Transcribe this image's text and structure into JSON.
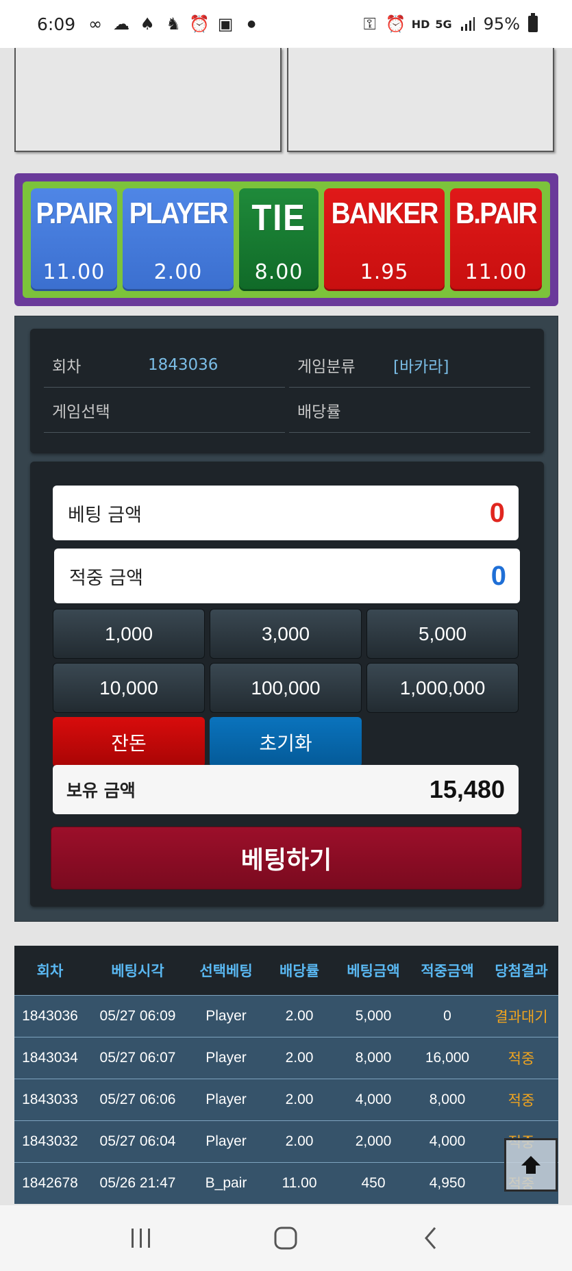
{
  "status_bar": {
    "time": "6:09",
    "battery": "95%",
    "network_hd": "HD",
    "network_5g": "5G"
  },
  "bet_options": [
    {
      "name": "P.PAIR",
      "odds": "11.00",
      "color": "#4f86e6"
    },
    {
      "name": "PLAYER",
      "odds": "2.00",
      "color": "#4f86e6"
    },
    {
      "name": "TIE",
      "odds": "8.00",
      "color": "#1f8a3a"
    },
    {
      "name": "BANKER",
      "odds": "1.95",
      "color": "#e01919"
    },
    {
      "name": "B.PAIR",
      "odds": "11.00",
      "color": "#e01919"
    }
  ],
  "info": {
    "round_label": "회차",
    "round_value": "1843036",
    "category_label": "게임분류",
    "category_value": "[바카라]",
    "selection_label": "게임선택",
    "selection_value": "",
    "odds_label": "배당률",
    "odds_value": ""
  },
  "bet_panel": {
    "bet_amount_label": "베팅 금액",
    "bet_amount_value": "0",
    "win_amount_label": "적중 금액",
    "win_amount_value": "0",
    "chips": [
      "1,000",
      "3,000",
      "5,000",
      "10,000",
      "100,000",
      "1,000,000"
    ],
    "balance_button": "잔돈",
    "reset_button": "초기화",
    "holding_label": "보유 금액",
    "holding_value": "15,480",
    "submit_label": "베팅하기"
  },
  "history": {
    "headers": [
      "회차",
      "베팅시각",
      "선택베팅",
      "배당률",
      "베팅금액",
      "적중금액",
      "당첨결과"
    ],
    "rows": [
      [
        "1843036",
        "05/27 06:09",
        "Player",
        "2.00",
        "5,000",
        "0",
        "결과대기"
      ],
      [
        "1843034",
        "05/27 06:07",
        "Player",
        "2.00",
        "8,000",
        "16,000",
        "적중"
      ],
      [
        "1843033",
        "05/27 06:06",
        "Player",
        "2.00",
        "4,000",
        "8,000",
        "적중"
      ],
      [
        "1843032",
        "05/27 06:04",
        "Player",
        "2.00",
        "2,000",
        "4,000",
        "적중"
      ],
      [
        "1842678",
        "05/26 21:47",
        "B_pair",
        "11.00",
        "450",
        "4,950",
        "적중"
      ]
    ]
  }
}
